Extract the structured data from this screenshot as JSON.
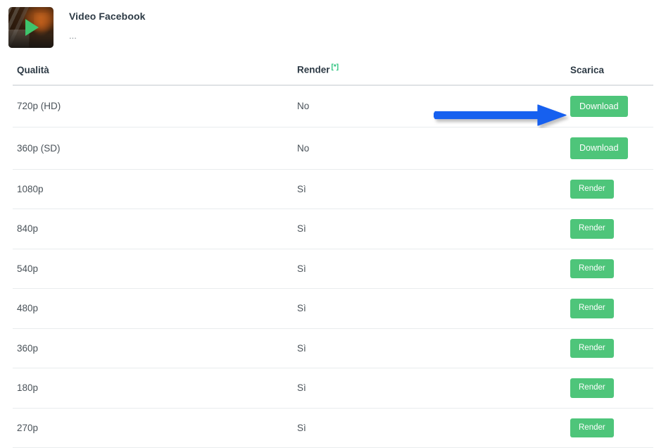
{
  "video": {
    "title": "Video Facebook",
    "subtitle": "...",
    "thumbnail_icon": "play-triangle-icon",
    "thumbnail_accent_color": "#3ec46c"
  },
  "table": {
    "columns": [
      {
        "key": "quality",
        "label": "Qualità"
      },
      {
        "key": "render",
        "label": "Render",
        "superscript": "[*]",
        "superscript_color": "#25c27a"
      },
      {
        "key": "scarica",
        "label": "Scarica"
      }
    ],
    "rows": [
      {
        "quality": "720p (HD)",
        "render": "No",
        "action_label": "Download",
        "action_type": "download"
      },
      {
        "quality": "360p (SD)",
        "render": "No",
        "action_label": "Download",
        "action_type": "download"
      },
      {
        "quality": "1080p",
        "render": "Sì",
        "action_label": "Render",
        "action_type": "render"
      },
      {
        "quality": "840p",
        "render": "Sì",
        "action_label": "Render",
        "action_type": "render"
      },
      {
        "quality": "540p",
        "render": "Sì",
        "action_label": "Render",
        "action_type": "render"
      },
      {
        "quality": "480p",
        "render": "Sì",
        "action_label": "Render",
        "action_type": "render"
      },
      {
        "quality": "360p",
        "render": "Sì",
        "action_label": "Render",
        "action_type": "render"
      },
      {
        "quality": "180p",
        "render": "Sì",
        "action_label": "Render",
        "action_type": "render"
      },
      {
        "quality": "270p",
        "render": "Sì",
        "action_label": "Render",
        "action_type": "render"
      }
    ]
  },
  "annotation": {
    "type": "arrow",
    "direction": "right",
    "color": "#1460ef",
    "points_to": "Download"
  },
  "colors": {
    "button_green": "#4ec57a",
    "arrow_blue": "#1460ef",
    "title_text": "#2d3a45",
    "body_text": "#4a5259",
    "row_divider": "#e9ecee",
    "header_divider": "#dfe2e5"
  }
}
